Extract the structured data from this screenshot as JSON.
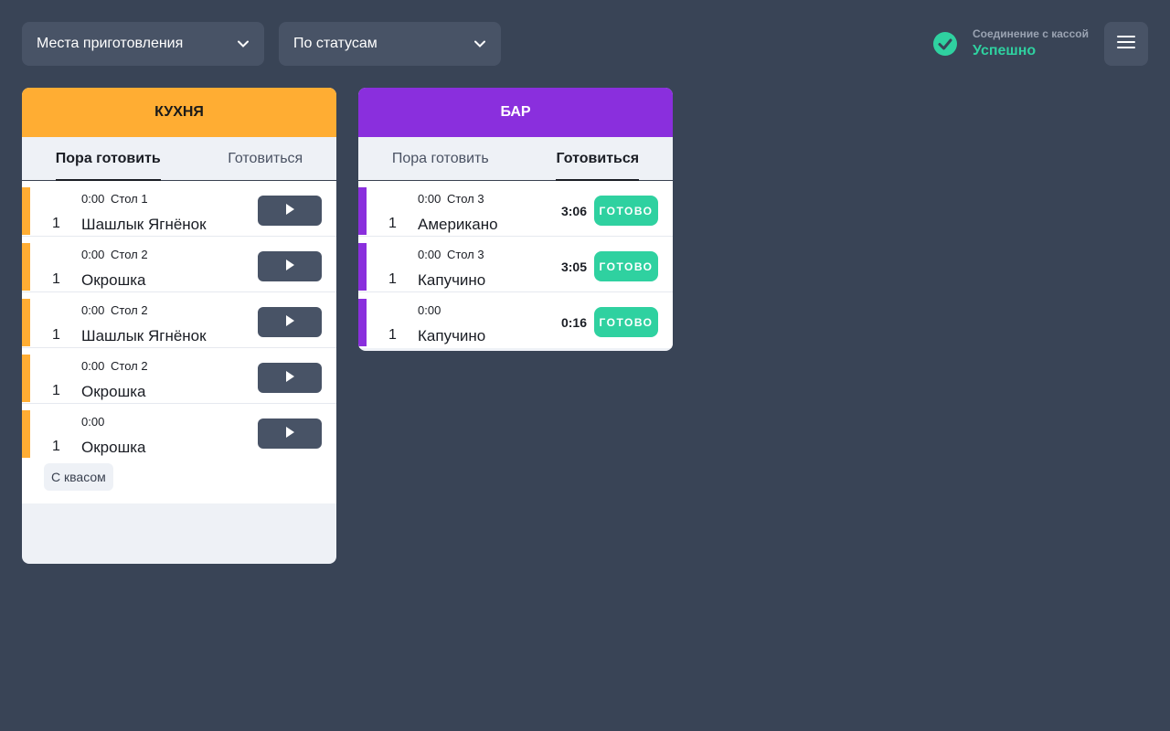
{
  "filters": {
    "places_label": "Места приготовления",
    "status_label": "По статусам"
  },
  "connection": {
    "label": "Соединение с кассой",
    "status": "Успешно",
    "status_color": "#2fd1a0"
  },
  "kitchen": {
    "title": "КУХНЯ",
    "accent": "#ffad33",
    "tabs": [
      "Пора готовить",
      "Готовиться"
    ],
    "active_tab": "Пора готовить",
    "orders": [
      {
        "time": "0:00",
        "table": "Стол 1",
        "qty": "1",
        "dish": "Шашлык Ягнёнок"
      },
      {
        "time": "0:00",
        "table": "Стол 2",
        "qty": "1",
        "dish": "Окрошка"
      },
      {
        "time": "0:00",
        "table": "Стол 2",
        "qty": "1",
        "dish": "Шашлык Ягнёнок"
      },
      {
        "time": "0:00",
        "table": "Стол 2",
        "qty": "1",
        "dish": "Окрошка"
      },
      {
        "time": "0:00",
        "table": "",
        "qty": "1",
        "dish": "Окрошка",
        "note": "С квасом"
      }
    ]
  },
  "bar": {
    "title": "БАР",
    "accent": "#8a2fdd",
    "tabs": [
      "Пора готовить",
      "Готовиться"
    ],
    "active_tab": "Готовиться",
    "done_label": "ГОТОВО",
    "orders": [
      {
        "time": "0:00",
        "table": "Стол 3",
        "qty": "1",
        "dish": "Американо",
        "timer": "3:06"
      },
      {
        "time": "0:00",
        "table": "Стол 3",
        "qty": "1",
        "dish": "Капучино",
        "timer": "3:05"
      },
      {
        "time": "0:00",
        "table": "",
        "qty": "1",
        "dish": "Капучино",
        "timer": "0:16"
      }
    ]
  },
  "icons": {
    "dropdown": "chevron-down-icon",
    "connection": "check-circle-icon",
    "menu": "hamburger-menu-icon",
    "start": "play-icon"
  }
}
